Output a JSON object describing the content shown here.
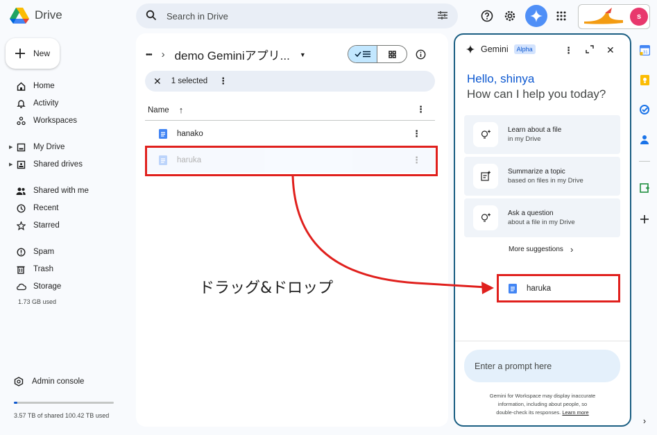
{
  "app": {
    "name": "Drive"
  },
  "search": {
    "placeholder": "Search in Drive"
  },
  "user": {
    "initial": "s"
  },
  "sidebar": {
    "new_label": "New",
    "items": [
      {
        "label": "Home",
        "icon": "home-icon"
      },
      {
        "label": "Activity",
        "icon": "bell-icon"
      },
      {
        "label": "Workspaces",
        "icon": "workspaces-icon"
      },
      {
        "label": "My Drive",
        "icon": "my-drive-icon"
      },
      {
        "label": "Shared drives",
        "icon": "shared-drives-icon"
      },
      {
        "label": "Shared with me",
        "icon": "people-icon"
      },
      {
        "label": "Recent",
        "icon": "clock-icon"
      },
      {
        "label": "Starred",
        "icon": "star-icon"
      },
      {
        "label": "Spam",
        "icon": "spam-icon"
      },
      {
        "label": "Trash",
        "icon": "trash-icon"
      },
      {
        "label": "Storage",
        "icon": "cloud-icon"
      }
    ],
    "storage_used": "1.73 GB used",
    "admin_console": "Admin console",
    "quota_text": "3.57 TB of shared 100.42 TB used",
    "quota_fraction": 0.036
  },
  "main": {
    "breadcrumb_more": "•••",
    "folder_title": "demo Geminiアプリ...",
    "selection_text": "1 selected",
    "column_name": "Name",
    "files": [
      {
        "name": "hanako"
      },
      {
        "name": "haruka"
      }
    ]
  },
  "annotation": {
    "drag_label": "ドラッグ&ドロップ",
    "color": "#e0201d"
  },
  "gemini": {
    "title": "Gemini",
    "badge": "Alpha",
    "greeting": "Hello, shinya",
    "question": "How can I help you today?",
    "suggestions": [
      {
        "title": "Learn about a file",
        "subtitle": "in my Drive"
      },
      {
        "title": "Summarize a topic",
        "subtitle": "based on files in my Drive"
      },
      {
        "title": "Ask a question",
        "subtitle": "about a file in my Drive"
      }
    ],
    "more_suggestions": "More suggestions",
    "dropped_file": "haruka",
    "prompt_placeholder": "Enter a prompt here",
    "disclaimer_line1": "Gemini for Workspace may display inaccurate",
    "disclaimer_line2": "information, including about people, so",
    "disclaimer_line3": "double-check its responses.",
    "learn_more": "Learn more"
  },
  "colors": {
    "accent": "#0b57d0",
    "doc_blue": "#4285f4",
    "gemini_border": "#1a5e82",
    "selected_row": "#e8f0fe"
  }
}
